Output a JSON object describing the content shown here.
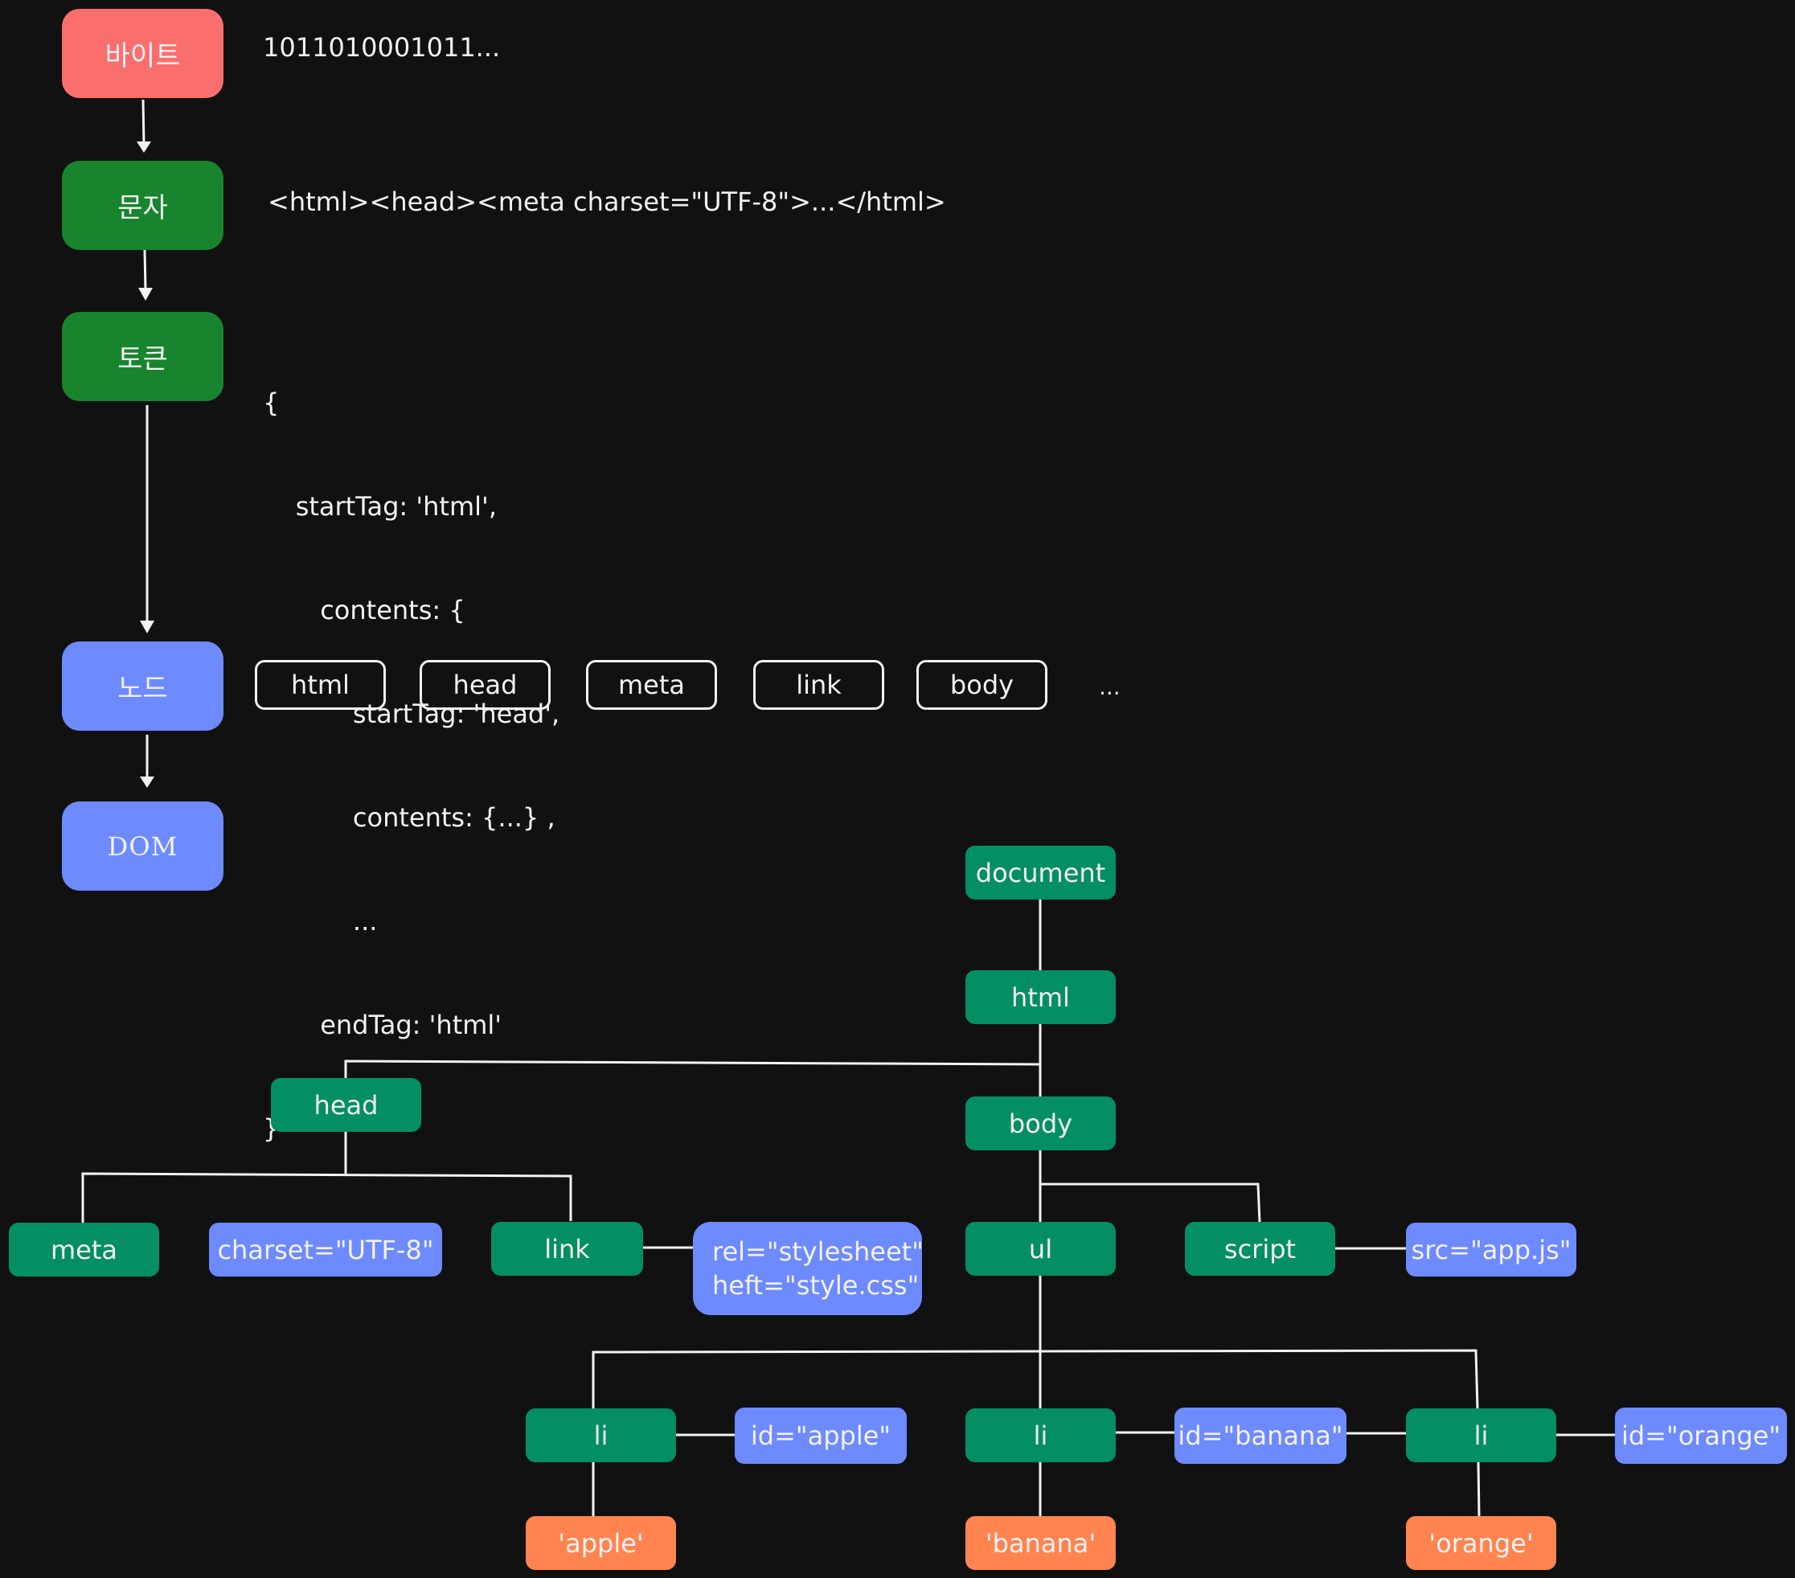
{
  "colors": {
    "background": "#111111",
    "bytes_stage": "#fa6e6e",
    "char_token_stage": "#19842e",
    "node_dom_stage": "#6e8aff",
    "element_node": "#038f63",
    "attribute_node": "#6e8aff",
    "text_node": "#ff8450",
    "line": "#f2f2f2"
  },
  "pipeline": {
    "stages": [
      {
        "id": "bytes",
        "label": "바이트",
        "description": "1011010001011..."
      },
      {
        "id": "characters",
        "label": "문자",
        "description": "<html><head><meta charset=\"UTF-8\">...</html>"
      },
      {
        "id": "tokens",
        "label": "토큰"
      },
      {
        "id": "nodes",
        "label": "노드"
      },
      {
        "id": "dom",
        "label": "DOM"
      }
    ],
    "token_code_lines": [
      "{",
      "    startTag: 'html',",
      "       contents: {",
      "           startTag: 'head',",
      "           contents: {...} ,",
      "           ...",
      "       endTag: 'html'",
      "}"
    ],
    "node_list": [
      "html",
      "head",
      "meta",
      "link",
      "body"
    ],
    "node_list_more": "..."
  },
  "dom_tree": {
    "document": "document",
    "html": "html",
    "head": "head",
    "body": "body",
    "meta": "meta",
    "meta_attr": "charset=\"UTF-8\"",
    "link": "link",
    "link_attr": "rel=\"stylesheet\"\nheft=\"style.css\"",
    "ul": "ul",
    "script": "script",
    "script_attr": "src=\"app.js\"",
    "li_items": [
      {
        "tag": "li",
        "attr": "id=\"apple\"",
        "text": "'apple'"
      },
      {
        "tag": "li",
        "attr": "id=\"banana\"",
        "text": "'banana'"
      },
      {
        "tag": "li",
        "attr": "id=\"orange\"",
        "text": "'orange'"
      }
    ]
  }
}
